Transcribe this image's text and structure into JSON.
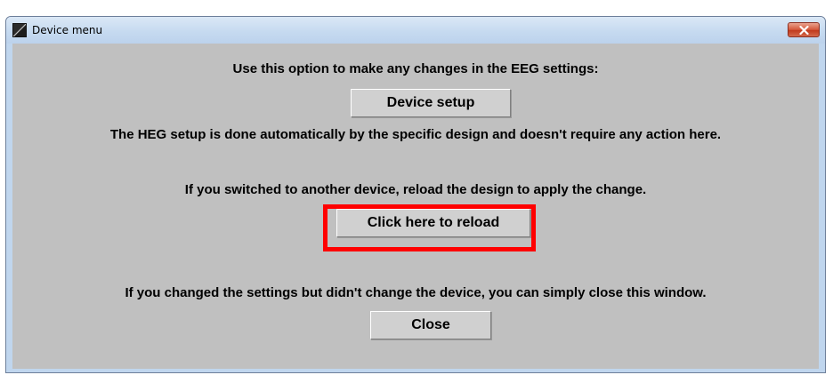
{
  "window": {
    "title": "Device menu"
  },
  "content": {
    "eeg_text": "Use this option to make any changes in the EEG settings:",
    "device_setup_label": "Device setup",
    "heg_text": "The HEG setup is done automatically by the specific design and doesn't require any action here.",
    "switch_text": "If you switched to another device, reload the design to apply the change.",
    "reload_label": "Click here to reload",
    "close_text": "If you changed the settings but didn't change the device, you can simply close this window.",
    "close_label": "Close"
  },
  "annotation": {
    "highlight_color": "#ff0000",
    "highlight_target": "reload-button"
  },
  "icons": [
    "app-icon",
    "close-icon"
  ]
}
